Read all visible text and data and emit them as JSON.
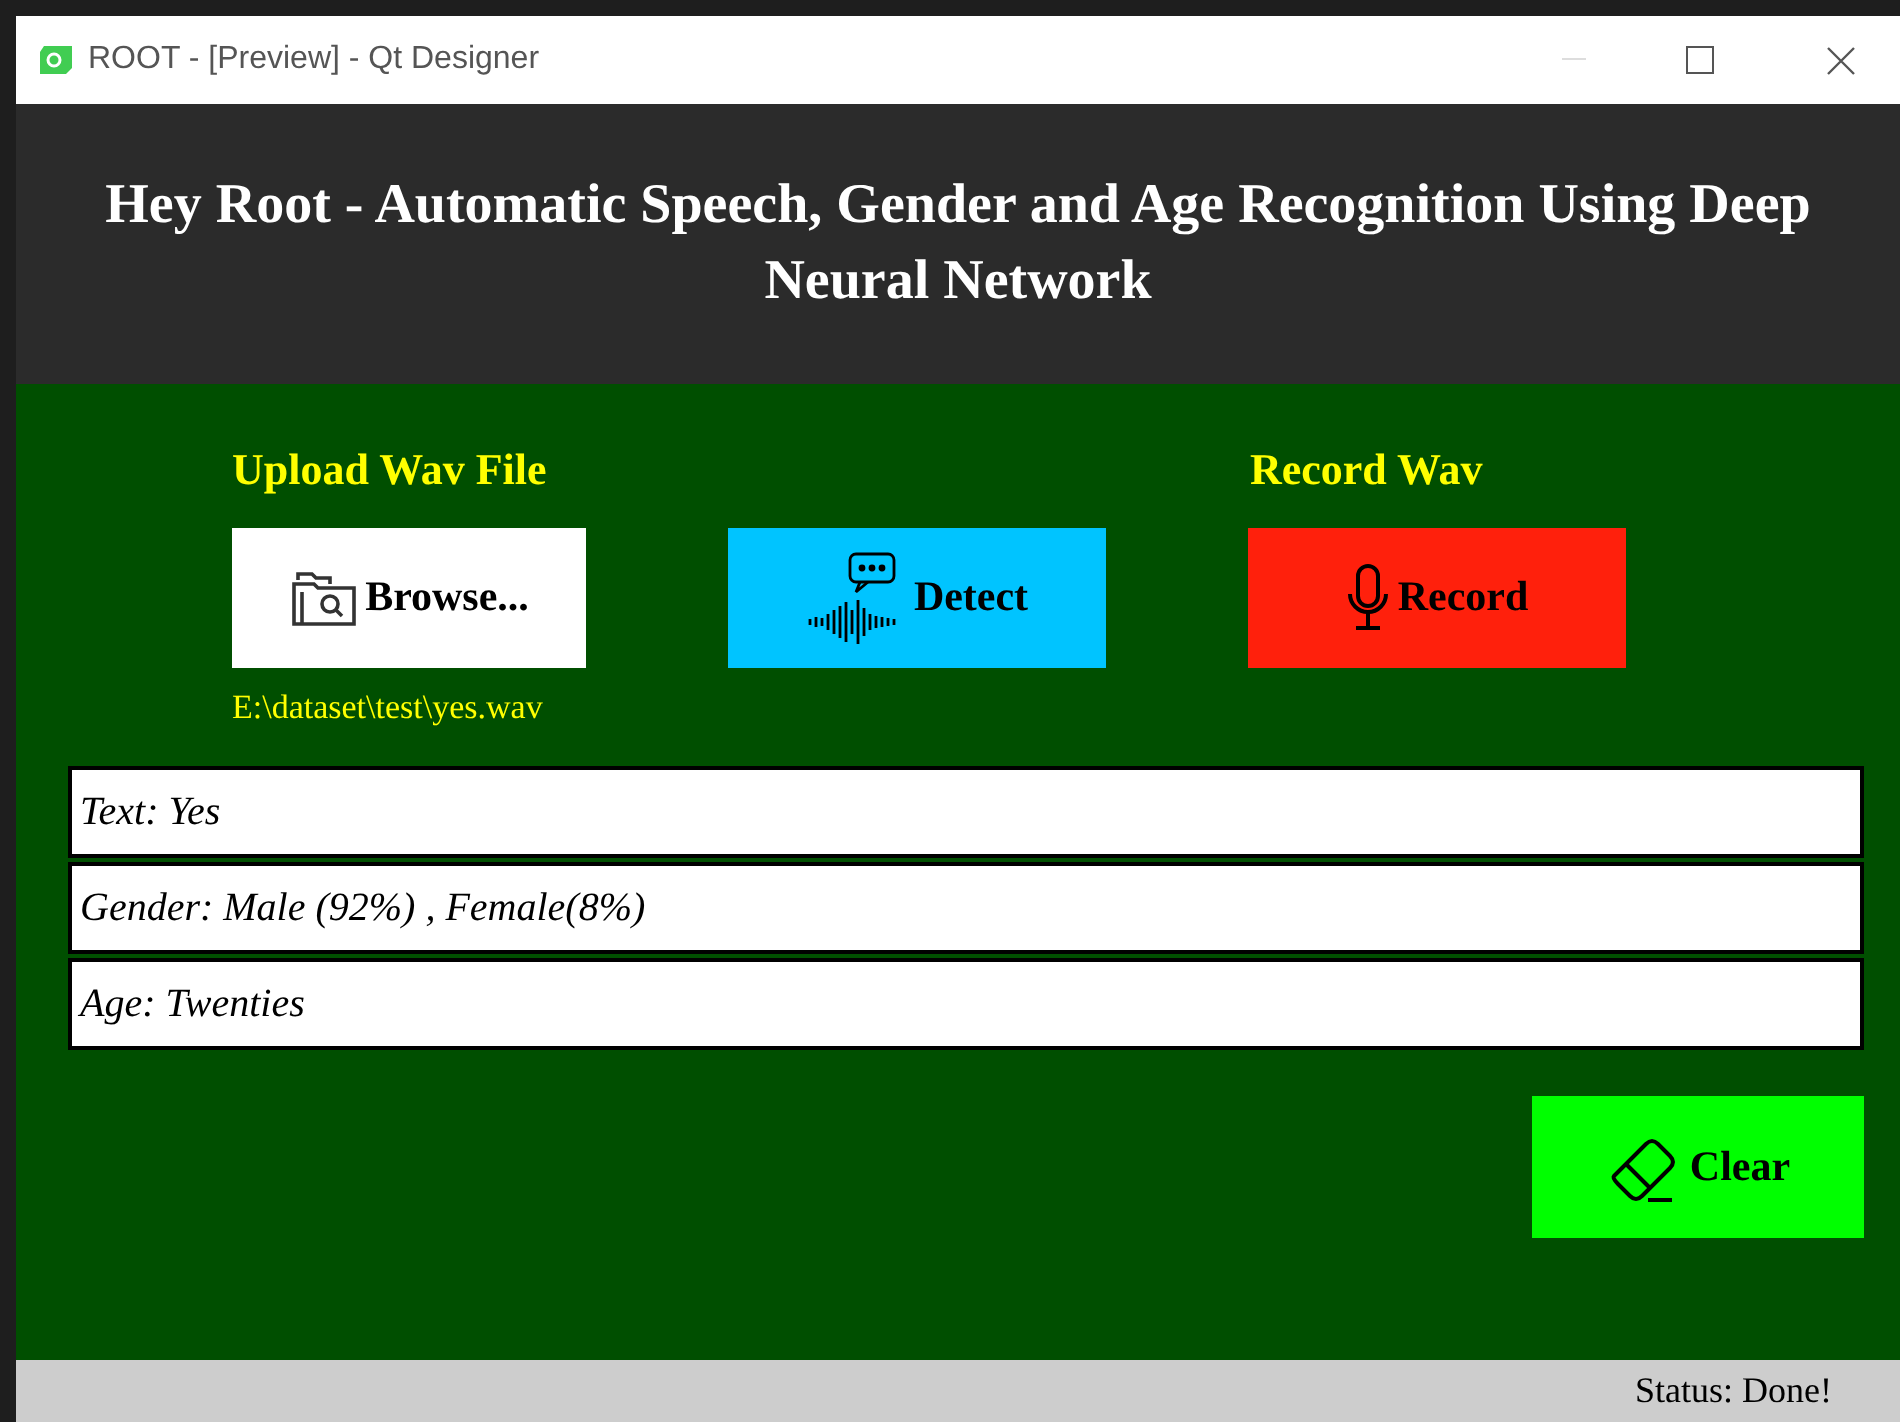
{
  "window": {
    "title": "ROOT - [Preview] - Qt Designer"
  },
  "header": {
    "title": "Hey Root - Automatic Speech, Gender and Age Recognition Using Deep Neural Network"
  },
  "upload_label": "Upload Wav File",
  "record_label": "Record Wav",
  "buttons": [
    {
      "kind": "browse",
      "label": "Browse..."
    },
    {
      "kind": "detect",
      "label": "Detect"
    },
    {
      "kind": "record",
      "label": "Record"
    }
  ],
  "file_path": "E:\\dataset\\test\\yes.wav",
  "results": [
    {
      "text": "Text: Yes"
    },
    {
      "text": "Gender: Male (92%) , Female(8%)"
    },
    {
      "text": "Age: Twenties"
    }
  ],
  "clear_button": {
    "label": "Clear"
  },
  "status_bar": {
    "text": "Status: Done!"
  }
}
